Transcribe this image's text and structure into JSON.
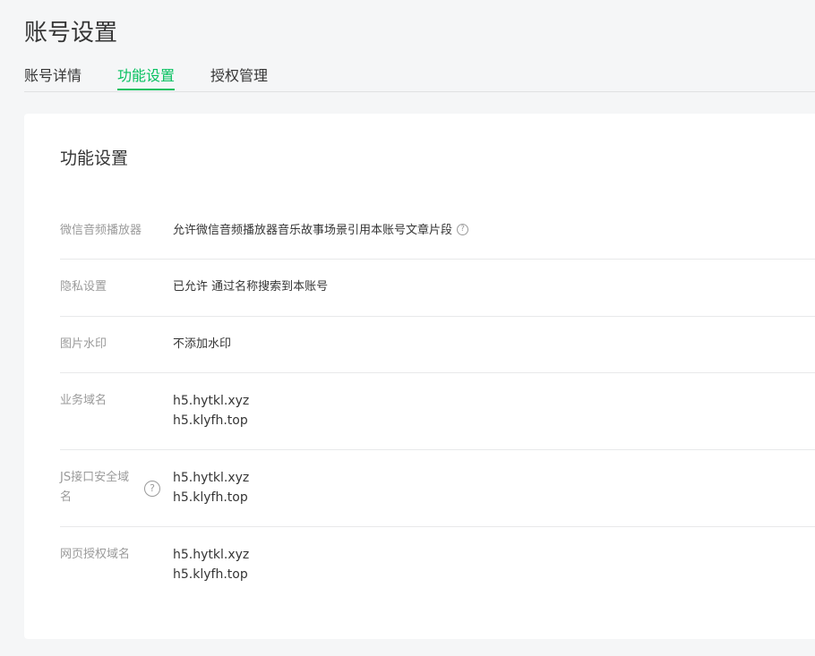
{
  "page": {
    "title": "账号设置"
  },
  "tabs": [
    {
      "label": "账号详情",
      "active": false
    },
    {
      "label": "功能设置",
      "active": true
    },
    {
      "label": "授权管理",
      "active": false
    }
  ],
  "section": {
    "title": "功能设置"
  },
  "settings": {
    "audio_player": {
      "label": "微信音频播放器",
      "value": "允许微信音频播放器音乐故事场景引用本账号文章片段",
      "help_icon": "question-circle-icon"
    },
    "privacy": {
      "label": "隐私设置",
      "value": "已允许 通过名称搜索到本账号"
    },
    "watermark": {
      "label": "图片水印",
      "value": "不添加水印"
    },
    "business_domain": {
      "label": "业务域名",
      "values": [
        "h5.hytkl.xyz",
        "h5.klyfh.top"
      ]
    },
    "js_secure_domain": {
      "label": "JS接口安全域名",
      "values": [
        "h5.hytkl.xyz",
        "h5.klyfh.top"
      ],
      "help_icon": "question-circle-icon"
    },
    "oauth_domain": {
      "label": "网页授权域名",
      "values": [
        "h5.hytkl.xyz",
        "h5.klyfh.top"
      ]
    }
  },
  "colors": {
    "accent": "#07c160",
    "label": "#9a9a9a",
    "text": "#353535",
    "background": "#f5f6f7",
    "card": "#ffffff"
  }
}
